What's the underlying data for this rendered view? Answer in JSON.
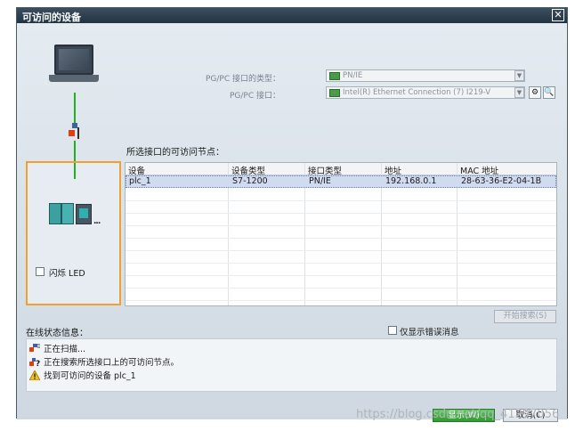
{
  "window": {
    "title": "可访问的设备",
    "close_label": "✕"
  },
  "pgpc": {
    "interface_type_label": "PG/PC 接口的类型：",
    "interface_type_value": "PN/IE",
    "interface_label": "PG/PC 接口：",
    "interface_value": "Intel(R) Ethernet Connection (7) I219-V"
  },
  "section_title": "所选接口的可访问节点：",
  "table": {
    "columns": [
      "设备",
      "设备类型",
      "接口类型",
      "地址",
      "MAC 地址"
    ],
    "rows": [
      [
        "plc_1",
        "S7-1200",
        "PN/IE",
        "192.168.0.1",
        "28-63-36-E2-04-1B"
      ]
    ]
  },
  "flash_led_label": "闪烁 LED",
  "start_search_label": "开始搜索(S)",
  "status": {
    "title": "在线状态信息：",
    "show_errors_label": "仅显示错误消息",
    "messages": [
      {
        "icon": "scan-icon",
        "text": "正在扫描..."
      },
      {
        "icon": "search-question-icon",
        "text": "正在搜索所选接口上的可访问节点。"
      },
      {
        "icon": "warning-icon",
        "text": "找到可访问的设备 plc_1"
      }
    ]
  },
  "buttons": {
    "show_label": "显示(W)",
    "cancel_label": "取消(C)"
  },
  "watermark": "https://blog.csdn.net/qq_41297056"
}
